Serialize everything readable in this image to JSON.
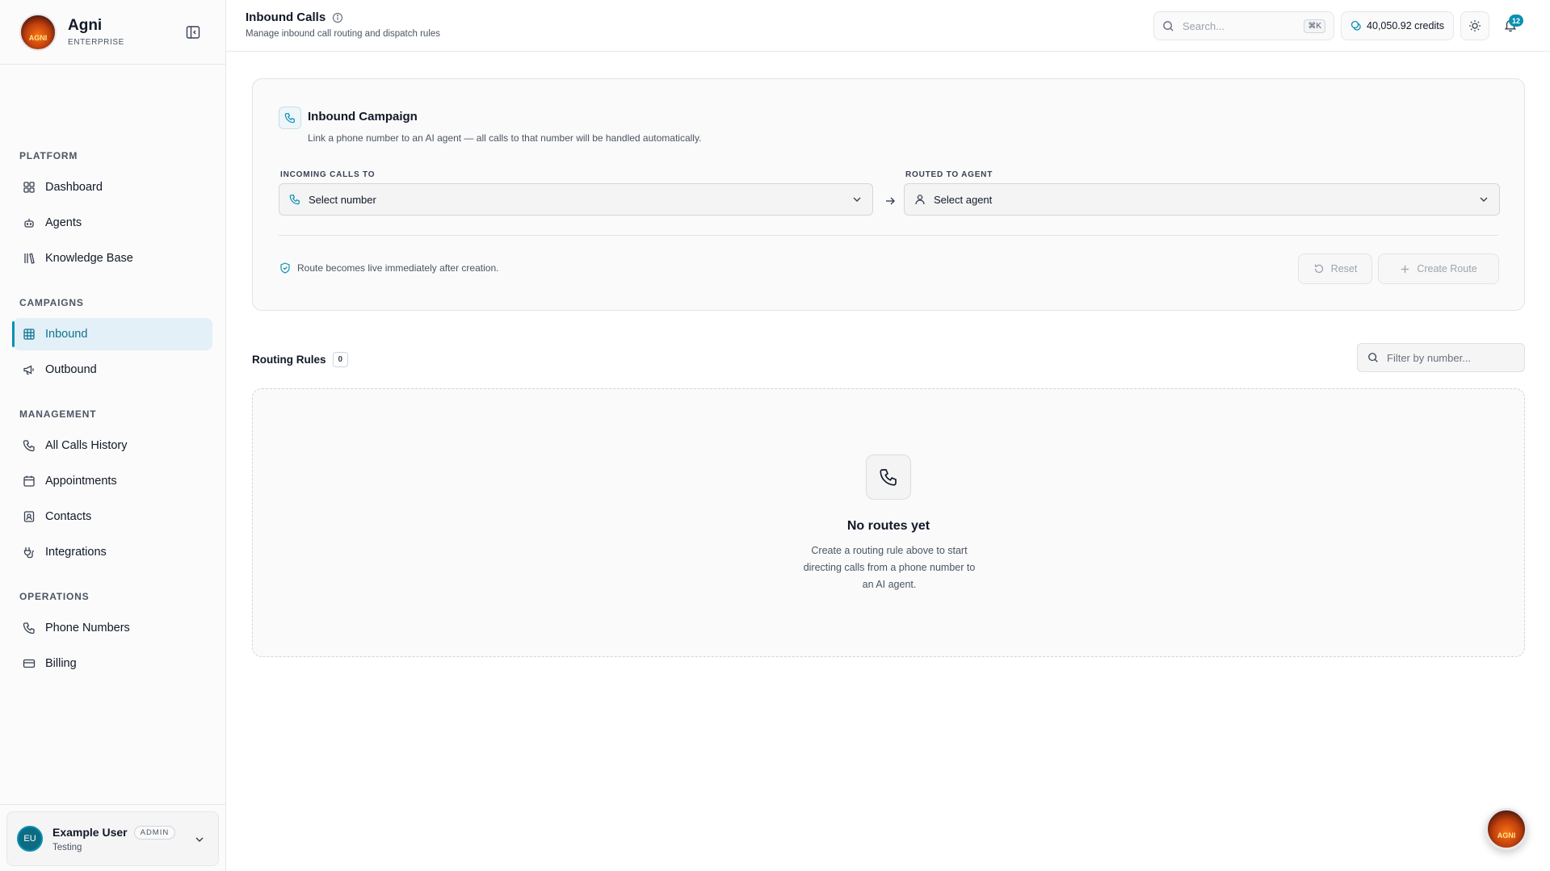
{
  "brand": {
    "name": "Agni",
    "tier": "ENTERPRISE",
    "logo_text": "AGNI"
  },
  "sidebar": {
    "sections": [
      {
        "heading": "PLATFORM",
        "items": [
          {
            "label": "Dashboard",
            "icon": "dashboard-icon"
          },
          {
            "label": "Agents",
            "icon": "bot-icon"
          },
          {
            "label": "Knowledge Base",
            "icon": "library-icon"
          }
        ]
      },
      {
        "heading": "CAMPAIGNS",
        "items": [
          {
            "label": "Inbound",
            "icon": "grid-icon",
            "active": true
          },
          {
            "label": "Outbound",
            "icon": "megaphone-icon"
          }
        ]
      },
      {
        "heading": "MANAGEMENT",
        "items": [
          {
            "label": "All Calls History",
            "icon": "phone-icon"
          },
          {
            "label": "Appointments",
            "icon": "calendar-icon"
          },
          {
            "label": "Contacts",
            "icon": "contact-icon"
          },
          {
            "label": "Integrations",
            "icon": "plug-icon"
          }
        ]
      },
      {
        "heading": "OPERATIONS",
        "items": [
          {
            "label": "Phone Numbers",
            "icon": "phone-icon"
          },
          {
            "label": "Billing",
            "icon": "credit-card-icon"
          }
        ]
      }
    ]
  },
  "user": {
    "initials": "EU",
    "name": "Example User",
    "role": "ADMIN",
    "org": "Testing"
  },
  "header": {
    "title": "Inbound Calls",
    "subtitle": "Manage inbound call routing and dispatch rules",
    "search_placeholder": "Search...",
    "search_shortcut": "⌘K",
    "credits": "40,050.92 credits",
    "notification_count": "12"
  },
  "campaign": {
    "title": "Inbound Campaign",
    "description": "Link a phone number to an AI agent — all calls to that number will be handled automatically.",
    "incoming_label": "INCOMING CALLS TO",
    "incoming_value": "Select number",
    "routed_label": "ROUTED TO AGENT",
    "routed_value": "Select agent",
    "notice": "Route becomes live immediately after creation.",
    "reset_label": "Reset",
    "create_label": "Create Route"
  },
  "rules": {
    "title": "Routing Rules",
    "count": "0",
    "filter_placeholder": "Filter by number...",
    "empty_title": "No routes yet",
    "empty_desc": "Create a routing rule above to start directing calls from a phone number to an AI agent."
  },
  "colors": {
    "accent": "#0891b2",
    "active_bg": "#e3f0f7"
  }
}
